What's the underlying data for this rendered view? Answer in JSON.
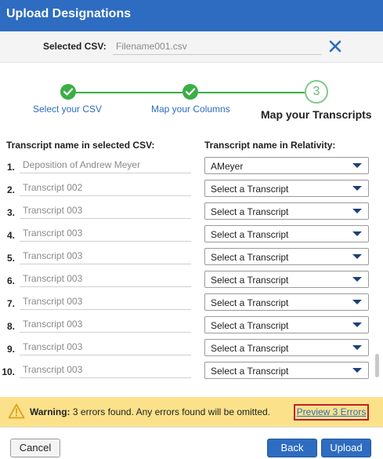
{
  "dialog": {
    "title": "Upload Designations"
  },
  "csv": {
    "label": "Selected CSV:",
    "filename": "Filename001.csv"
  },
  "steps": [
    {
      "label": "Select your CSV",
      "status": "complete"
    },
    {
      "label": "Map your Columns",
      "status": "complete"
    },
    {
      "label": "Map your Transcripts",
      "number": "3",
      "status": "current"
    }
  ],
  "columns": {
    "left": "Transcript name in selected CSV:",
    "right": "Transcript name in Relativity:"
  },
  "rows": [
    {
      "num": "1.",
      "csv_name": "Deposition of Andrew Meyer",
      "selected": "AMeyer"
    },
    {
      "num": "2.",
      "csv_name": "Transcript 002",
      "selected": "Select a Transcript"
    },
    {
      "num": "3.",
      "csv_name": "Transcript 003",
      "selected": "Select a Transcript"
    },
    {
      "num": "4.",
      "csv_name": "Transcript 003",
      "selected": "Select a Transcript"
    },
    {
      "num": "5.",
      "csv_name": "Transcript 003",
      "selected": "Select a Transcript"
    },
    {
      "num": "6.",
      "csv_name": "Transcript 003",
      "selected": "Select a Transcript"
    },
    {
      "num": "7.",
      "csv_name": "Transcript 003",
      "selected": "Select a Transcript"
    },
    {
      "num": "8.",
      "csv_name": "Transcript 003",
      "selected": "Select a Transcript"
    },
    {
      "num": "9.",
      "csv_name": "Transcript 003",
      "selected": "Select a Transcript"
    },
    {
      "num": "10.",
      "csv_name": "Transcript 003",
      "selected": "Select a Transcript"
    }
  ],
  "warning": {
    "label": "Warning:",
    "message": "3 errors found. Any errors found will be omitted.",
    "link": "Preview 3 Errors"
  },
  "buttons": {
    "cancel": "Cancel",
    "back": "Back",
    "upload": "Upload"
  },
  "colors": {
    "accent": "#2d6cc0",
    "success": "#3cae46",
    "warning_bg": "#fbe28a",
    "error_border": "#c0202a"
  },
  "icons": {
    "close": "close-icon",
    "check": "check-icon",
    "warning": "warning-icon",
    "dropdown": "chevron-down-icon"
  }
}
